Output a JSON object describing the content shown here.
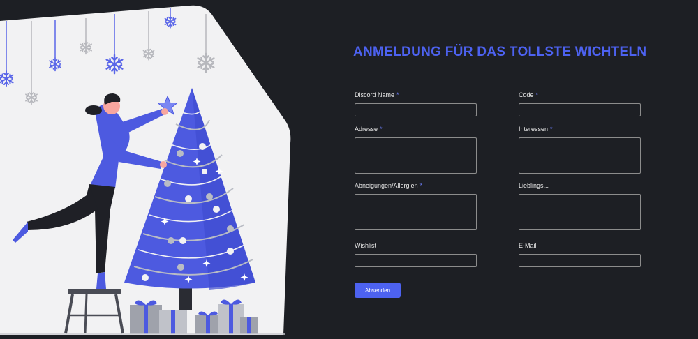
{
  "form": {
    "title": "ANMELDUNG FÜR DAS TOLLSTE WICHTELN",
    "required_marker": "*",
    "fields": {
      "discord_name": {
        "label": "Discord Name",
        "value": ""
      },
      "code": {
        "label": "Code",
        "value": ""
      },
      "adresse": {
        "label": "Adresse",
        "value": ""
      },
      "interessen": {
        "label": "Interessen",
        "value": ""
      },
      "abneigungen": {
        "label": "Abneigungen/Allergien",
        "value": ""
      },
      "lieblings": {
        "label": "Lieblings...",
        "value": ""
      },
      "wishlist": {
        "label": "Wishlist",
        "value": ""
      },
      "email": {
        "label": "E-Mail",
        "value": ""
      }
    },
    "submit_label": "Absenden"
  },
  "colors": {
    "background": "#1d1f24",
    "accent": "#4d62f0",
    "panel": "#f2f2f3",
    "tree": "#4d5ae0"
  },
  "illustration": {
    "icons": [
      "snowflake-icon",
      "star-icon",
      "christmas-tree",
      "person",
      "stool",
      "gift-box"
    ]
  }
}
